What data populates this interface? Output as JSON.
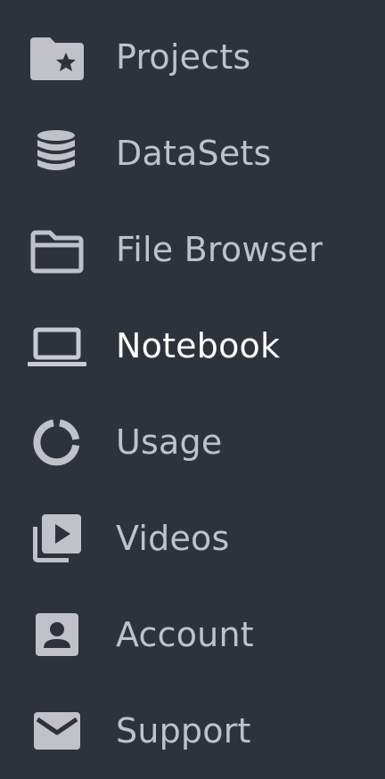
{
  "sidebar": {
    "items": [
      {
        "label": "Projects",
        "icon": "folder-star-icon",
        "active": false
      },
      {
        "label": "DataSets",
        "icon": "database-icon",
        "active": false
      },
      {
        "label": "File Browser",
        "icon": "folder-outline-icon",
        "active": false
      },
      {
        "label": "Notebook",
        "icon": "laptop-icon",
        "active": true
      },
      {
        "label": "Usage",
        "icon": "donut-chart-icon",
        "active": false
      },
      {
        "label": "Videos",
        "icon": "video-library-icon",
        "active": false
      },
      {
        "label": "Account",
        "icon": "account-box-icon",
        "active": false
      },
      {
        "label": "Support",
        "icon": "mail-icon",
        "active": false
      }
    ]
  },
  "colors": {
    "background": "#2e323b",
    "text": "#c0c2c7",
    "active_text": "#ffffff"
  }
}
